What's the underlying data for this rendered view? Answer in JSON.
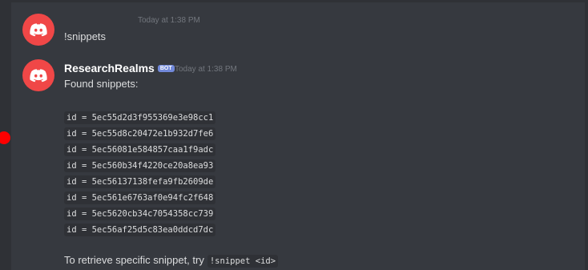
{
  "message1": {
    "timestamp": "Today at 1:38 PM",
    "text": "!snippets"
  },
  "message2": {
    "author": "ResearchRealms",
    "bot_badge": "BOT",
    "timestamp": "Today at 1:38 PM",
    "intro": "Found snippets:",
    "snippets": [
      "id = 5ec55d2d3f955369e3e98cc1",
      "id = 5ec55d8c20472e1b932d7fe6",
      "id = 5ec56081e584857caa1f9adc",
      "id = 5ec560b34f4220ce20a8ea93",
      "id = 5ec56137138fefa9fb2609de",
      "id = 5ec561e6763af0e94fc2f648",
      "id = 5ec5620cb34c7054358cc739",
      "id = 5ec56af25d5c83ea0ddcd7dc"
    ],
    "footer_text": "To retrieve specific snippet, try",
    "footer_code": "!snippet <id>"
  },
  "colors": {
    "background": "#36393f",
    "avatar": "#f04747",
    "bot_badge": "#7289da",
    "code_bg": "#2f3136"
  },
  "icons": {
    "avatar": "discord-logo-icon"
  }
}
